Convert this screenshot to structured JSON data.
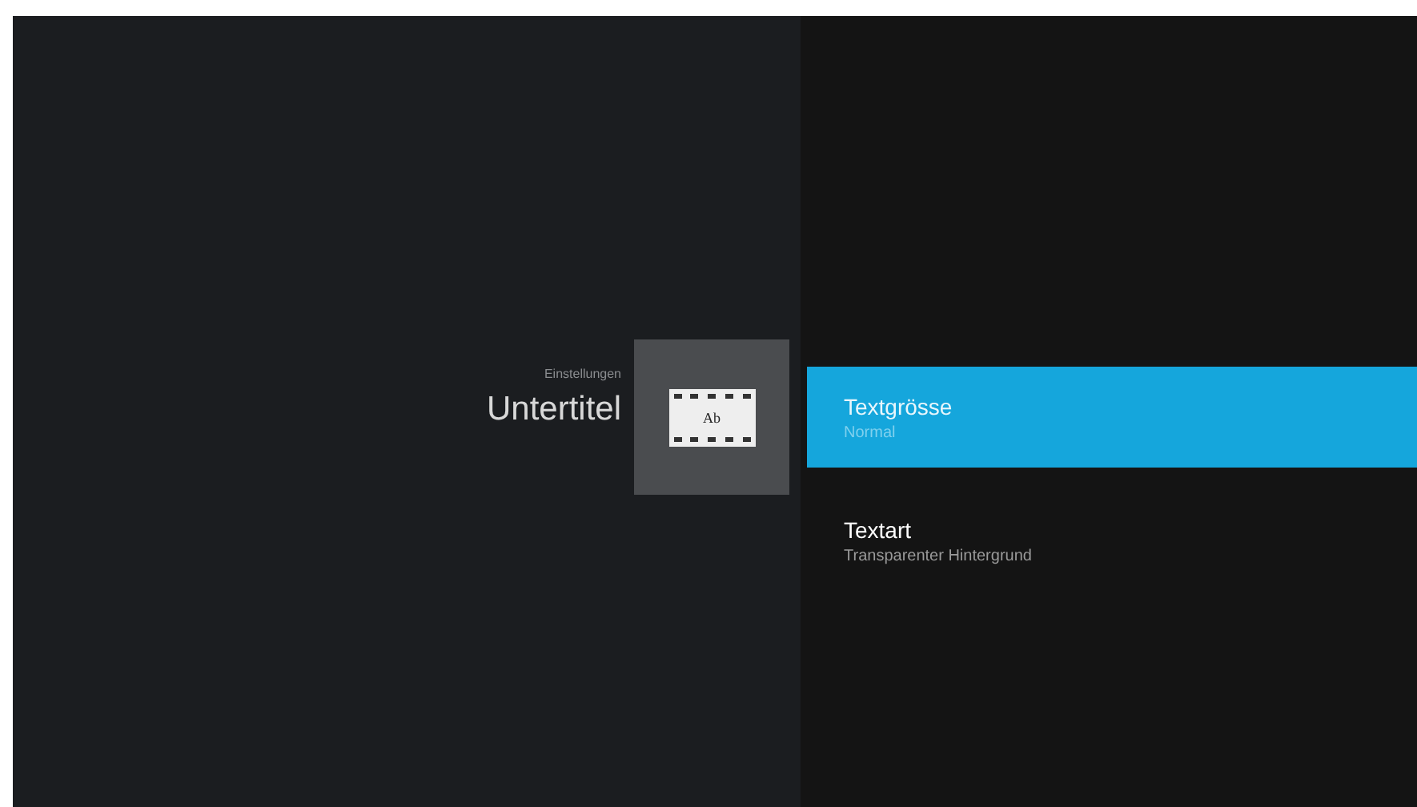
{
  "header": {
    "breadcrumb": "Einstellungen",
    "title": "Untertitel",
    "icon_text": "Ab"
  },
  "items": [
    {
      "title": "Textgrösse",
      "subtitle": "Normal",
      "selected": true
    },
    {
      "title": "Textart",
      "subtitle": "Transparenter Hintergrund",
      "selected": false
    }
  ]
}
